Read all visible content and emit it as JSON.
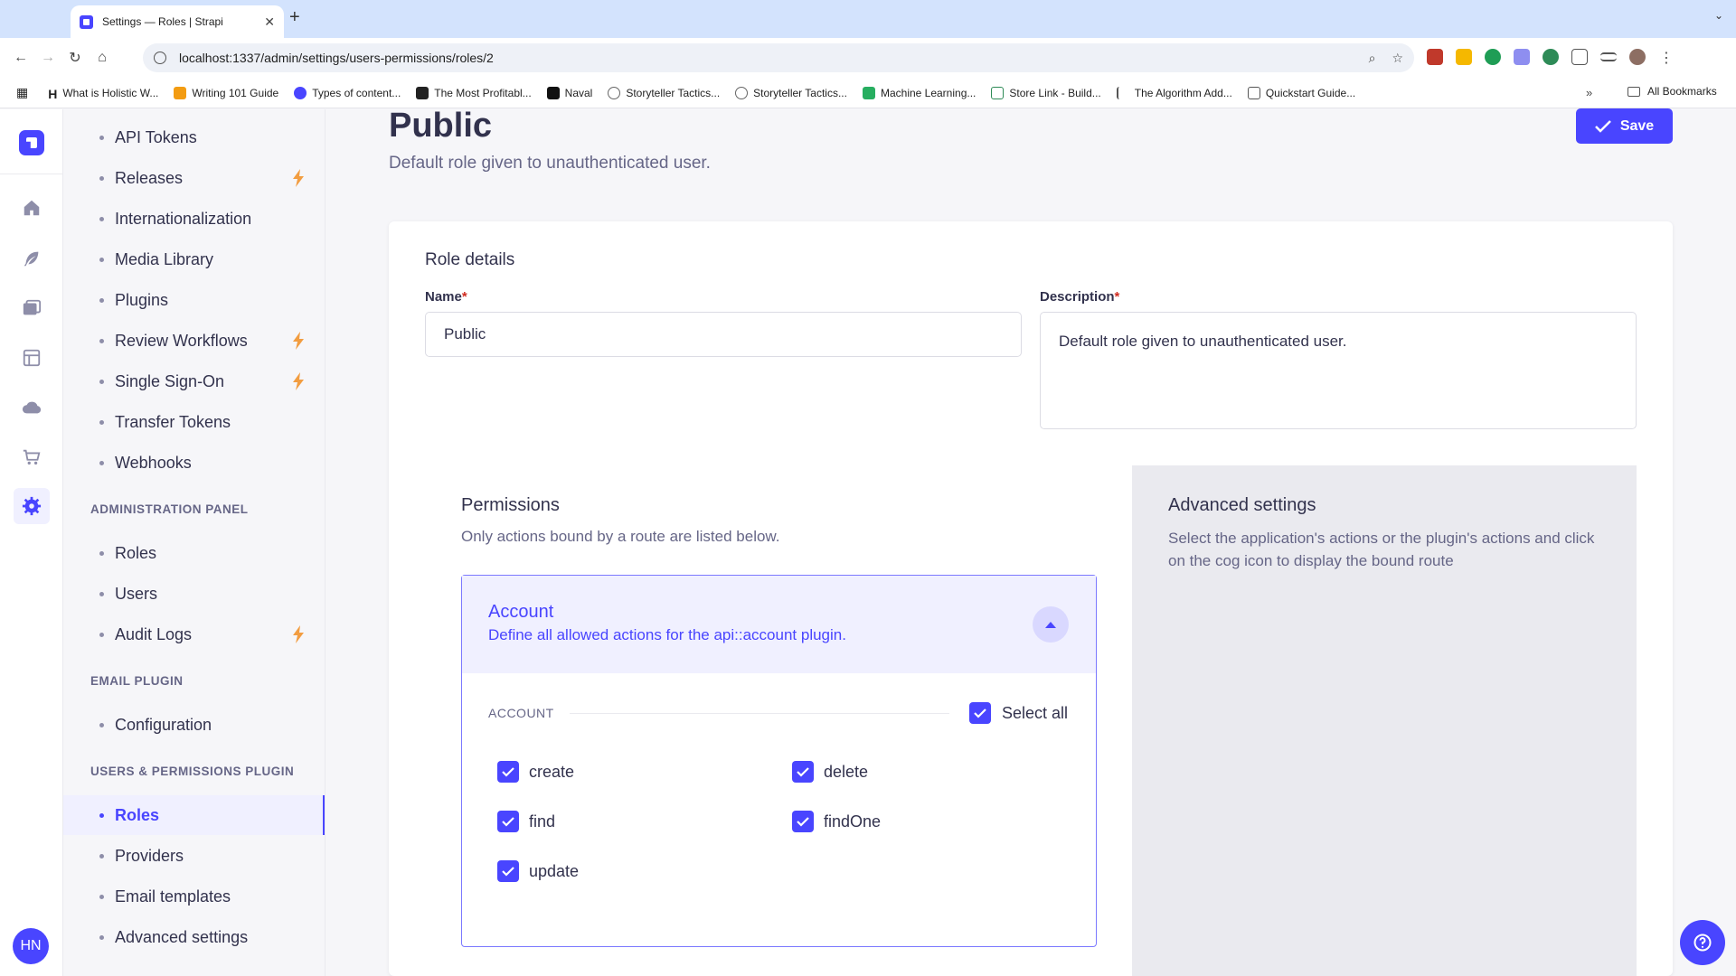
{
  "browser": {
    "tab_title": "Settings — Roles | Strapi",
    "url": "localhost:1337/admin/settings/users-permissions/roles/2",
    "bookmarks": [
      "What is Holistic W...",
      "Writing 101 Guide",
      "Types of content...",
      "The Most Profitabl...",
      "Naval",
      "Storyteller Tactics...",
      "Storyteller Tactics...",
      "Machine Learning...",
      "Store Link - Build...",
      "The Algorithm Add...",
      "Quickstart Guide..."
    ],
    "all_bookmarks": "All Bookmarks"
  },
  "rail": {
    "avatar_initials": "HN",
    "icons": [
      "home-icon",
      "feather-icon",
      "media-icon",
      "layout-icon",
      "cloud-icon",
      "cart-icon",
      "settings-icon"
    ]
  },
  "subnav": {
    "items_top": [
      {
        "label": "API Tokens",
        "bolt": false
      },
      {
        "label": "Releases",
        "bolt": true
      },
      {
        "label": "Internationalization",
        "bolt": false
      },
      {
        "label": "Media Library",
        "bolt": false
      },
      {
        "label": "Plugins",
        "bolt": false
      },
      {
        "label": "Review Workflows",
        "bolt": true
      },
      {
        "label": "Single Sign-On",
        "bolt": true
      },
      {
        "label": "Transfer Tokens",
        "bolt": false
      },
      {
        "label": "Webhooks",
        "bolt": false
      }
    ],
    "section_admin": "ADMINISTRATION PANEL",
    "items_admin": [
      {
        "label": "Roles",
        "bolt": false
      },
      {
        "label": "Users",
        "bolt": false
      },
      {
        "label": "Audit Logs",
        "bolt": true
      }
    ],
    "section_email": "EMAIL PLUGIN",
    "items_email": [
      {
        "label": "Configuration",
        "bolt": false
      }
    ],
    "section_up": "USERS & PERMISSIONS PLUGIN",
    "items_up": [
      {
        "label": "Roles",
        "active": true
      },
      {
        "label": "Providers",
        "active": false
      },
      {
        "label": "Email templates",
        "active": false
      },
      {
        "label": "Advanced settings",
        "active": false
      }
    ]
  },
  "header": {
    "title": "Public",
    "subtitle": "Default role given to unauthenticated user.",
    "save_label": "Save"
  },
  "role_details": {
    "heading": "Role details",
    "name_label": "Name",
    "name_value": "Public",
    "description_label": "Description",
    "description_value": "Default role given to unauthenticated user.",
    "required_mark": "*"
  },
  "permissions": {
    "title": "Permissions",
    "subtitle": "Only actions bound by a route are listed below.",
    "accordion": {
      "title": "Account",
      "description": "Define all allowed actions for the api::account plugin.",
      "group_label": "ACCOUNT",
      "select_all_label": "Select all",
      "actions": [
        {
          "label": "create",
          "checked": true
        },
        {
          "label": "delete",
          "checked": true
        },
        {
          "label": "find",
          "checked": true
        },
        {
          "label": "findOne",
          "checked": true
        },
        {
          "label": "update",
          "checked": true
        }
      ]
    }
  },
  "advanced": {
    "title": "Advanced settings",
    "description": "Select the application's actions or the plugin's actions and click on the cog icon to display the bound route"
  },
  "colors": {
    "primary": "#4945ff",
    "warning": "#f29d41",
    "required": "#d02b20"
  }
}
